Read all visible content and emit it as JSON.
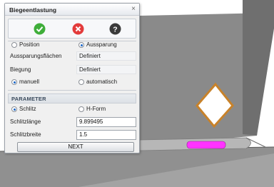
{
  "dialog": {
    "title": "Biegeentlastung",
    "close_glyph": "×",
    "actions": [
      {
        "name": "ok",
        "icon": "check-circle-icon",
        "color": "#3fae3a"
      },
      {
        "name": "cancel",
        "icon": "x-circle-icon",
        "color": "#e33b3b"
      },
      {
        "name": "help",
        "icon": "question-circle-icon",
        "color": "#3a3a3a"
      }
    ]
  },
  "type_options": {
    "position_label": "Position",
    "aussparung_label": "Aussparung",
    "selected": "Aussparung"
  },
  "fields": {
    "aussparungsflaechen_label": "Aussparungsflächen",
    "aussparungsflaechen_value": "Definiert",
    "biegung_label": "Biegung",
    "biegung_value": "Definiert"
  },
  "mode_options": {
    "manuell_label": "manuell",
    "automatisch_label": "automatisch",
    "selected": "manuell"
  },
  "parameter": {
    "header": "PARAMETER",
    "schlitz_label": "Schlitz",
    "hform_label": "H-Form",
    "selected": "Schlitz",
    "schlitzlaenge_label": "Schlitzlänge",
    "schlitzlaenge_value": "9.899495",
    "schlitzbreite_label": "Schlitzbreite",
    "schlitzbreite_value": "1.5",
    "next_label": "NEXT"
  },
  "colors": {
    "slot_highlight": "#ff33ff",
    "part_outline": "#c8822a"
  }
}
